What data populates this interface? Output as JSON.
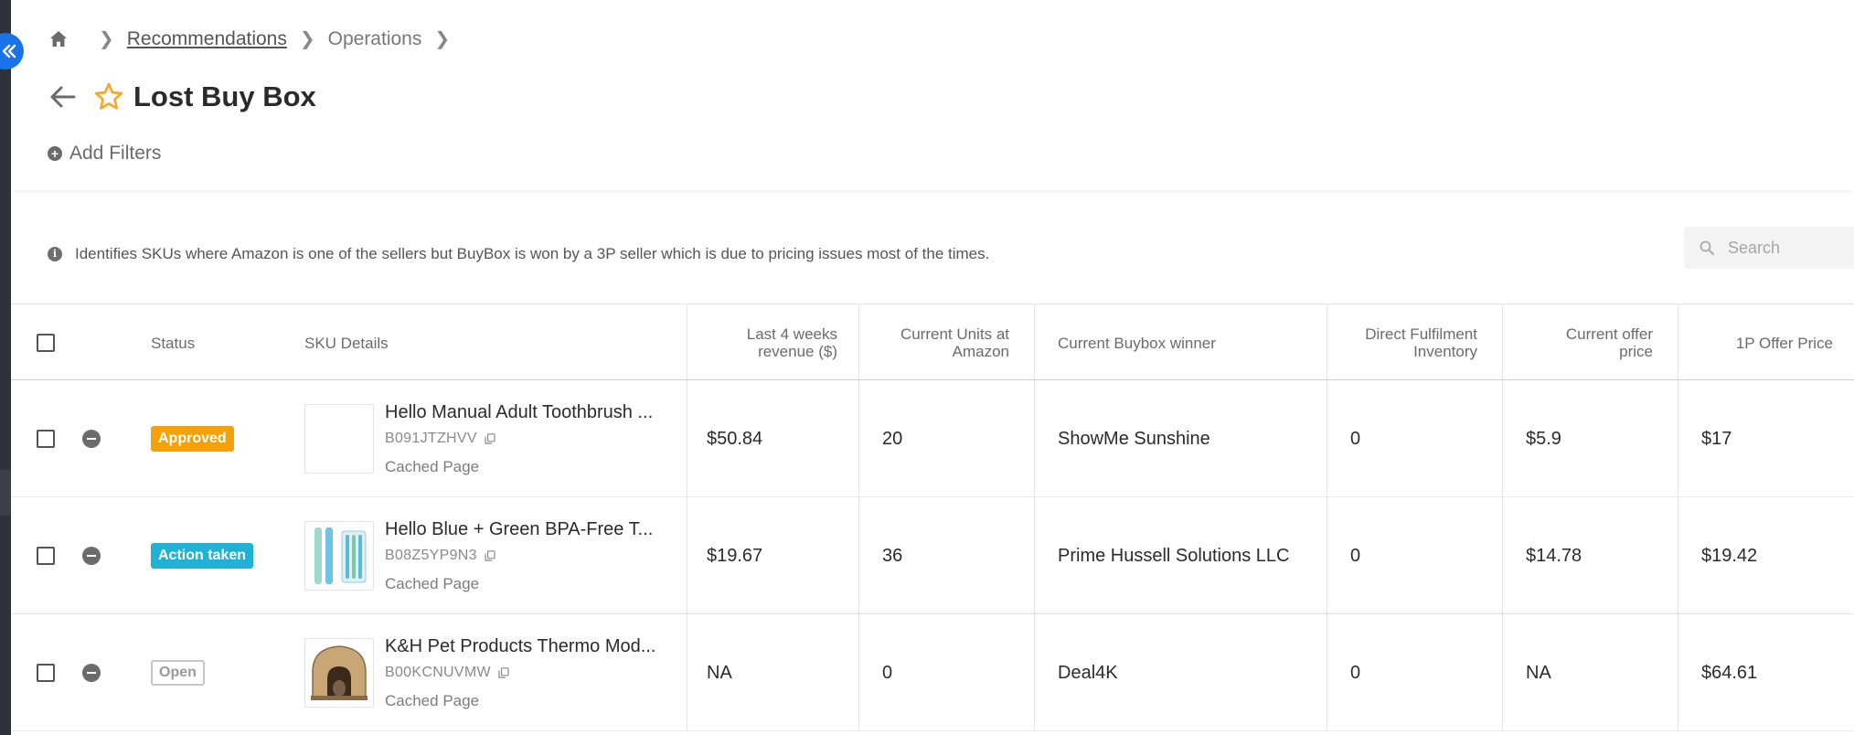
{
  "breadcrumb": {
    "items": [
      "Recommendations",
      "Operations"
    ]
  },
  "page": {
    "title": "Lost Buy Box"
  },
  "filters": {
    "add_label": "Add Filters"
  },
  "info": {
    "text": "Identifies SKUs where Amazon is one of the sellers but BuyBox is won by a 3P seller which is due to pricing issues most of the times."
  },
  "search": {
    "placeholder": "Search"
  },
  "table": {
    "columns": {
      "status": "Status",
      "sku_details": "SKU Details",
      "revenue_line1": "Last 4 weeks",
      "revenue_line2": "revenue ($)",
      "units_line1": "Current Units at",
      "units_line2": "Amazon",
      "buybox_winner": "Current Buybox winner",
      "df_line1": "Direct Fulfilment",
      "df_line2": "Inventory",
      "offer_line1": "Current offer",
      "offer_line2": "price",
      "first_party_price": "1P Offer Price"
    },
    "rows": [
      {
        "status": "Approved",
        "title": "Hello Manual Adult Toothbrush ...",
        "asin": "B091JTZHVV",
        "cache": "Cached Page",
        "revenue": "$50.84",
        "units": "20",
        "winner": "ShowMe Sunshine",
        "df_inventory": "0",
        "offer_price": "$5.9",
        "first_party_price": "$17"
      },
      {
        "status": "Action taken",
        "title": "Hello Blue + Green BPA-Free T...",
        "asin": "B08Z5YP9N3",
        "cache": "Cached Page",
        "revenue": "$19.67",
        "units": "36",
        "winner": "Prime Hussell Solutions LLC",
        "df_inventory": "0",
        "offer_price": "$14.78",
        "first_party_price": "$19.42"
      },
      {
        "status": "Open",
        "title": "K&H Pet Products Thermo Mod...",
        "asin": "B00KCNUVMW",
        "cache": "Cached Page",
        "revenue": "NA",
        "units": "0",
        "winner": "Deal4K",
        "df_inventory": "0",
        "offer_price": "NA",
        "first_party_price": "$64.61"
      }
    ]
  },
  "colors": {
    "approved": "#f5a10a",
    "action_taken": "#21b1d4",
    "accent": "#1a73e8",
    "star": "#f5a623"
  }
}
